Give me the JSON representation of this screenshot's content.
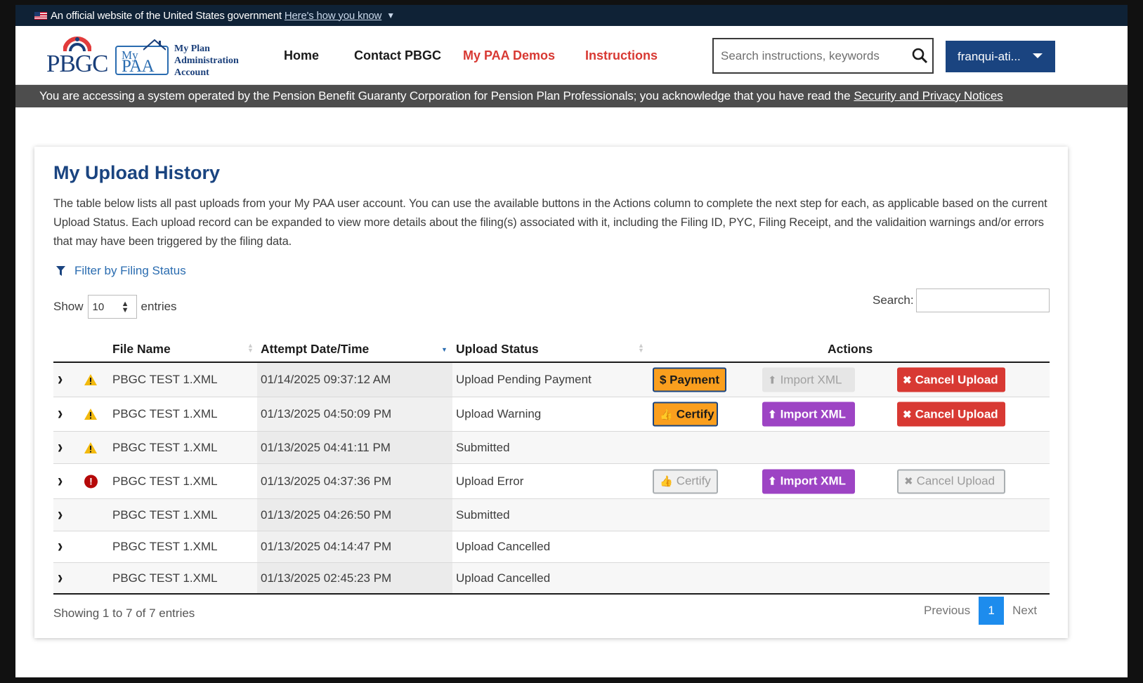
{
  "gov_banner": {
    "text": "An official website of the United States government",
    "link": "Here's how you know"
  },
  "logo": {
    "agency": "PBGC",
    "my": "My",
    "paa": "PAA",
    "subtitle_1": "My Plan",
    "subtitle_2": "Administration",
    "subtitle_3": "Account"
  },
  "nav": {
    "home": "Home",
    "contact": "Contact PBGC",
    "demos": "My PAA Demos",
    "instructions": "Instructions"
  },
  "search": {
    "placeholder": "Search instructions, keywords"
  },
  "user": {
    "name": "franqui-ati..."
  },
  "notice": {
    "text": "You are accessing a system operated by the Pension Benefit Guaranty Corporation for Pension Plan Professionals; you acknowledge that you have read the",
    "link": "Security and Privacy Notices"
  },
  "card": {
    "title": "My Upload History",
    "description": "The table below lists all past uploads from your My PAA user account. You can use the available buttons in the Actions column to complete the next step for each, as applicable based on the current Upload Status. Each upload record can be expanded to view more details about the filing(s) associated with it, including the Filing ID, PYC, Filing Receipt, and the validaition warnings and/or errors that may have been triggered by the filing data.",
    "filter_label": "Filter by Filing Status",
    "show_label": "Show",
    "show_value": "10",
    "entries_label": "entries",
    "search_label": "Search:"
  },
  "table": {
    "headers": {
      "file": "File Name",
      "date": "Attempt Date/Time",
      "status": "Upload Status",
      "actions": "Actions"
    },
    "rows": [
      {
        "icon": "warning",
        "file": "PBGC TEST 1.XML",
        "date": "01/14/2025 09:37:12 AM",
        "status": "Upload Pending Payment",
        "primary": "$ Payment",
        "import": "Import XML",
        "cancel": "Cancel Upload"
      },
      {
        "icon": "warning",
        "file": "PBGC TEST 1.XML",
        "date": "01/13/2025 04:50:09 PM",
        "status": "Upload Warning",
        "primary": "Certify",
        "import": "Import XML",
        "cancel": "Cancel Upload"
      },
      {
        "icon": "warning",
        "file": "PBGC TEST 1.XML",
        "date": "01/13/2025 04:41:11 PM",
        "status": "Submitted"
      },
      {
        "icon": "error",
        "file": "PBGC TEST 1.XML",
        "date": "01/13/2025 04:37:36 PM",
        "status": "Upload Error",
        "primary": "Certify",
        "import": "Import XML",
        "cancel": "Cancel Upload"
      },
      {
        "icon": "none",
        "file": "PBGC TEST 1.XML",
        "date": "01/13/2025 04:26:50 PM",
        "status": "Submitted"
      },
      {
        "icon": "none",
        "file": "PBGC TEST 1.XML",
        "date": "01/13/2025 04:14:47 PM",
        "status": "Upload Cancelled"
      },
      {
        "icon": "none",
        "file": "PBGC TEST 1.XML",
        "date": "01/13/2025 02:45:23 PM",
        "status": "Upload Cancelled"
      }
    ]
  },
  "pagination": {
    "info": "Showing 1 to 7 of 7 entries",
    "previous": "Previous",
    "page": "1",
    "next": "Next"
  },
  "colors": {
    "navy": "#1a4480",
    "red": "#d83933",
    "orange": "#fa9f1e",
    "purple": "#9d44c4",
    "blue": "#1d8ced"
  }
}
